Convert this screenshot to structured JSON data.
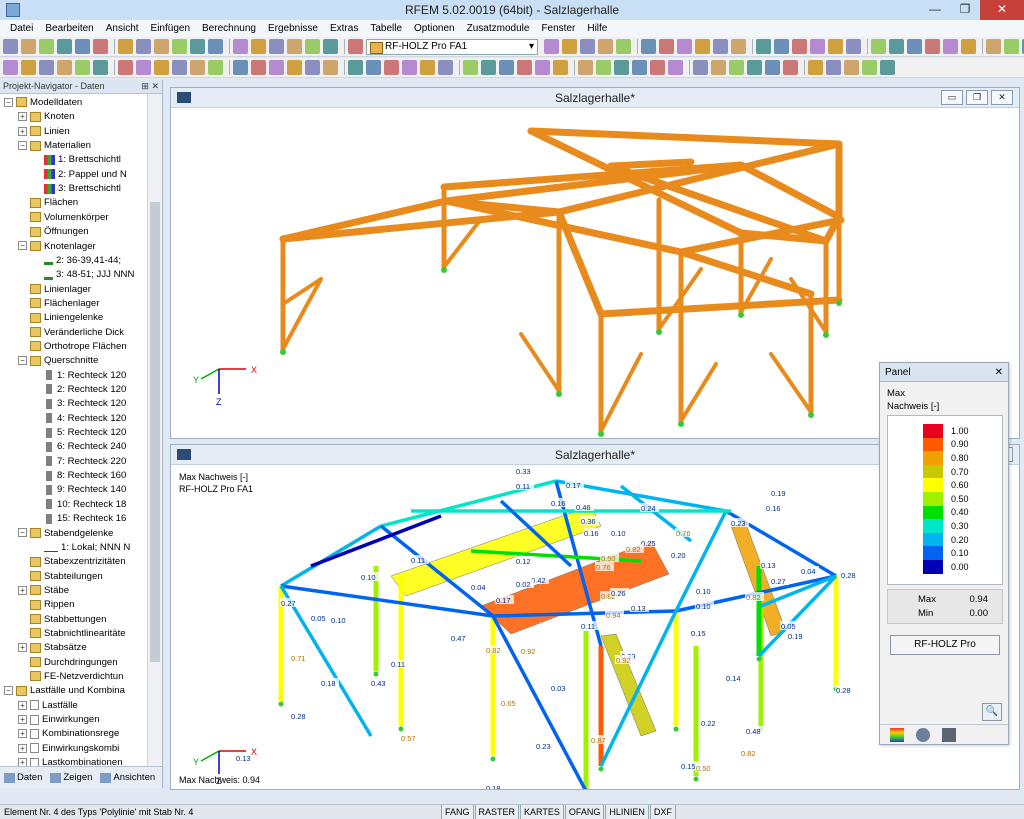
{
  "window": {
    "title": "RFEM 5.02.0019 (64bit) - Salzlagerhalle",
    "controls": [
      "—",
      "❐",
      "✕"
    ]
  },
  "menu": [
    "Datei",
    "Bearbeiten",
    "Ansicht",
    "Einfügen",
    "Berechnung",
    "Ergebnisse",
    "Extras",
    "Tabelle",
    "Optionen",
    "Zusatzmodule",
    "Fenster",
    "Hilfe"
  ],
  "toolbar": {
    "module_combo": "RF-HOLZ Pro FA1"
  },
  "navigator": {
    "title": "Projekt-Navigator - Daten",
    "header_buttons": "⊞ ✕",
    "tree": [
      {
        "label": "Modelldaten",
        "level": 1,
        "exp": "−",
        "icon": "folder"
      },
      {
        "label": "Knoten",
        "level": 2,
        "exp": "+",
        "icon": "folder"
      },
      {
        "label": "Linien",
        "level": 2,
        "exp": "+",
        "icon": "folder"
      },
      {
        "label": "Materialien",
        "level": 2,
        "exp": "−",
        "icon": "folder"
      },
      {
        "label": "1: Brettschichtl",
        "level": 3,
        "exp": "",
        "icon": "mat"
      },
      {
        "label": "2: Pappel und N",
        "level": 3,
        "exp": "",
        "icon": "mat"
      },
      {
        "label": "3: Brettschichtl",
        "level": 3,
        "exp": "",
        "icon": "mat"
      },
      {
        "label": "Flächen",
        "level": 2,
        "exp": "",
        "icon": "folder"
      },
      {
        "label": "Volumenkörper",
        "level": 2,
        "exp": "",
        "icon": "folder"
      },
      {
        "label": "Öffnungen",
        "level": 2,
        "exp": "",
        "icon": "folder"
      },
      {
        "label": "Knotenlager",
        "level": 2,
        "exp": "−",
        "icon": "folder"
      },
      {
        "label": "2: 36-39,41-44;",
        "level": 3,
        "exp": "",
        "icon": "sup"
      },
      {
        "label": "3: 48-51; JJJ NNN",
        "level": 3,
        "exp": "",
        "icon": "sup"
      },
      {
        "label": "Linienlager",
        "level": 2,
        "exp": "",
        "icon": "folder"
      },
      {
        "label": "Flächenlager",
        "level": 2,
        "exp": "",
        "icon": "folder"
      },
      {
        "label": "Liniengelenke",
        "level": 2,
        "exp": "",
        "icon": "folder"
      },
      {
        "label": "Veränderliche Dick",
        "level": 2,
        "exp": "",
        "icon": "folder"
      },
      {
        "label": "Orthotrope Flächen",
        "level": 2,
        "exp": "",
        "icon": "folder"
      },
      {
        "label": "Querschnitte",
        "level": 2,
        "exp": "−",
        "icon": "folder"
      },
      {
        "label": "1: Rechteck 120",
        "level": 3,
        "exp": "",
        "icon": "cs"
      },
      {
        "label": "2: Rechteck 120",
        "level": 3,
        "exp": "",
        "icon": "cs"
      },
      {
        "label": "3: Rechteck 120",
        "level": 3,
        "exp": "",
        "icon": "cs"
      },
      {
        "label": "4: Rechteck 120",
        "level": 3,
        "exp": "",
        "icon": "cs"
      },
      {
        "label": "5: Rechteck 120",
        "level": 3,
        "exp": "",
        "icon": "cs"
      },
      {
        "label": "6: Rechteck 240",
        "level": 3,
        "exp": "",
        "icon": "cs"
      },
      {
        "label": "7: Rechteck 220",
        "level": 3,
        "exp": "",
        "icon": "cs"
      },
      {
        "label": "8: Rechteck 160",
        "level": 3,
        "exp": "",
        "icon": "cs"
      },
      {
        "label": "9: Rechteck 140",
        "level": 3,
        "exp": "",
        "icon": "cs"
      },
      {
        "label": "10: Rechteck 18",
        "level": 3,
        "exp": "",
        "icon": "cs"
      },
      {
        "label": "15: Rechteck 16",
        "level": 3,
        "exp": "",
        "icon": "cs"
      },
      {
        "label": "Stabendgelenke",
        "level": 2,
        "exp": "−",
        "icon": "folder"
      },
      {
        "label": "1: Lokal; NNN N",
        "level": 3,
        "exp": "",
        "icon": "hinge"
      },
      {
        "label": "Stabexzentrizitäten",
        "level": 2,
        "exp": "",
        "icon": "folder"
      },
      {
        "label": "Stabteilungen",
        "level": 2,
        "exp": "",
        "icon": "folder"
      },
      {
        "label": "Stäbe",
        "level": 2,
        "exp": "+",
        "icon": "folder"
      },
      {
        "label": "Rippen",
        "level": 2,
        "exp": "",
        "icon": "folder"
      },
      {
        "label": "Stabbettungen",
        "level": 2,
        "exp": "",
        "icon": "folder"
      },
      {
        "label": "Stabnichtlinearitäte",
        "level": 2,
        "exp": "",
        "icon": "folder"
      },
      {
        "label": "Stabsätze",
        "level": 2,
        "exp": "+",
        "icon": "folder"
      },
      {
        "label": "Durchdringungen",
        "level": 2,
        "exp": "",
        "icon": "folder"
      },
      {
        "label": "FE-Netzverdichtun",
        "level": 2,
        "exp": "",
        "icon": "folder"
      },
      {
        "label": "Lastfälle und Kombina",
        "level": 1,
        "exp": "−",
        "icon": "folder"
      },
      {
        "label": "Lastfälle",
        "level": 2,
        "exp": "+",
        "icon": "page"
      },
      {
        "label": "Einwirkungen",
        "level": 2,
        "exp": "+",
        "icon": "page"
      },
      {
        "label": "Kombinationsrege",
        "level": 2,
        "exp": "+",
        "icon": "page"
      },
      {
        "label": "Einwirkungskombi",
        "level": 2,
        "exp": "+",
        "icon": "page"
      },
      {
        "label": "Lastkombinationen",
        "level": 2,
        "exp": "+",
        "icon": "page"
      }
    ],
    "tabs": [
      "Daten",
      "Zeigen",
      "Ansichten"
    ]
  },
  "view1": {
    "title": "Salzlagerhalle*",
    "buttons": [
      "▭",
      "❐",
      "✕"
    ],
    "axes": {
      "x": "X",
      "y": "Y",
      "z": "Z"
    },
    "member_color": "#e98a1c"
  },
  "view2": {
    "title": "Salzlagerhalle*",
    "buttons": [
      "▭",
      "❐",
      "✕"
    ],
    "info_line1": "Max Nachweis [-]",
    "info_line2": "RF-HOLZ Pro FA1",
    "bottom_text": "Max Nachweis: 0.94",
    "labels": [
      "0.33",
      "0.11",
      "0.16",
      "0.17",
      "0.36",
      "0.46",
      "0.24",
      "0.16",
      "0.10",
      "0.76",
      "0.25",
      "0.19",
      "0.16",
      "0.82",
      "0.76",
      "0.13",
      "0.20",
      "0.23",
      "0.04",
      "0.28",
      "0.11",
      "0.04",
      "0.42",
      "0.10",
      "0.17",
      "0.27",
      "0.27",
      "0.02",
      "0.12",
      "0.05",
      "0.10",
      "0.13",
      "0.94",
      "0.82",
      "0.10",
      "0.05",
      "0.19",
      "0.71",
      "0.47",
      "0.82",
      "0.92",
      "0.39",
      "0.11",
      "0.92",
      "0.15",
      "0.26",
      "0.82",
      "0.11",
      "0.50",
      "0.10",
      "0.43",
      "0.03",
      "0.14",
      "0.18",
      "0.28",
      "0.28",
      "0.65",
      "0.87",
      "0.22",
      "0.23",
      "0.13",
      "0.57",
      "0.15",
      "0.48",
      "0.82",
      "0.50",
      "0.18",
      "0.36"
    ],
    "axes": {
      "x": "X",
      "y": "Y",
      "z": "Z"
    }
  },
  "panel": {
    "title": "Panel",
    "close": "✕",
    "line1": "Max",
    "line2": "Nachweis [-]",
    "legend": [
      {
        "value": "1.00",
        "color": "#e8001c"
      },
      {
        "value": "0.90",
        "color": "#ff5a00"
      },
      {
        "value": "0.80",
        "color": "#f0a000"
      },
      {
        "value": "0.70",
        "color": "#c8c800"
      },
      {
        "value": "0.60",
        "color": "#ffff00"
      },
      {
        "value": "0.50",
        "color": "#a0f000"
      },
      {
        "value": "0.40",
        "color": "#00e000"
      },
      {
        "value": "0.30",
        "color": "#00e6c8"
      },
      {
        "value": "0.20",
        "color": "#00b4f0"
      },
      {
        "value": "0.10",
        "color": "#0064f0"
      },
      {
        "value": "0.00",
        "color": "#0000b4"
      }
    ],
    "max_label": "Max",
    "max_value": "0.94",
    "min_label": "Min",
    "min_value": "0.00",
    "button": "RF-HOLZ Pro",
    "zoom": "🔍"
  },
  "status": {
    "text": "Element Nr. 4 des Typs 'Polylinie' mit Stab Nr. 4",
    "cells": [
      "FANG",
      "RASTER",
      "KARTES",
      "OFANG",
      "HLINIEN",
      "DXF"
    ]
  }
}
